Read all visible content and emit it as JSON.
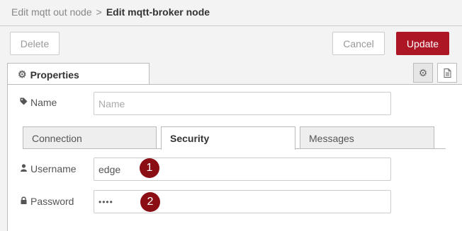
{
  "breadcrumb": {
    "parent": "Edit mqtt out node",
    "separator": ">",
    "current": "Edit mqtt-broker node"
  },
  "toolbar": {
    "delete_label": "Delete",
    "cancel_label": "Cancel",
    "update_label": "Update"
  },
  "tabs": {
    "properties_label": "Properties"
  },
  "fields": {
    "name_label": "Name",
    "name_placeholder": "Name",
    "username_label": "Username",
    "username_value": "edge",
    "password_label": "Password",
    "password_value": "••••"
  },
  "subtabs": [
    "Connection",
    "Security",
    "Messages"
  ],
  "active_subtab": "Security",
  "annotations": {
    "badge_1": "1",
    "badge_2": "2"
  },
  "colors": {
    "accent": "#ad1625",
    "badge": "#8b0e15"
  },
  "icons": [
    "gear-icon",
    "document-icon",
    "tag-icon",
    "user-icon",
    "lock-icon"
  ]
}
